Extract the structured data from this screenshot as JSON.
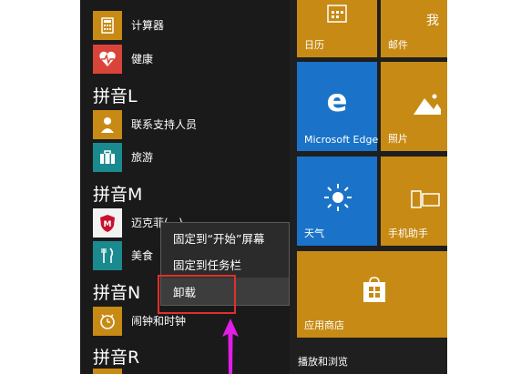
{
  "app_list": {
    "items": [
      {
        "label": "计算器",
        "name": "calculator"
      },
      {
        "label": "健康",
        "name": "health"
      },
      {
        "label": "联系支持人员",
        "name": "contact-support"
      },
      {
        "label": "旅游",
        "name": "travel"
      },
      {
        "label": "迈克菲(...)",
        "name": "mcafee"
      },
      {
        "label": "美食",
        "name": "food"
      },
      {
        "label": "闹钟和时钟",
        "name": "alarms-clock"
      }
    ],
    "headers": [
      "拼音L",
      "拼音M",
      "拼音N",
      "拼音R"
    ]
  },
  "tiles": {
    "calendar": "日历",
    "mail": "邮件",
    "edge": "Microsoft Edge",
    "photos": "照片",
    "weather": "天气",
    "phone_companion": "手机助手",
    "store": "应用商店",
    "group_label": "播放和浏览",
    "top_right_char": "我"
  },
  "context_menu": {
    "items": [
      "固定到“开始”屏幕",
      "固定到任务栏",
      "卸载"
    ]
  },
  "colors": {
    "tile_orange": "#c78a14",
    "tile_blue": "#1a73c8",
    "highlight_red": "#e0302c",
    "arrow_magenta": "#e01ee8"
  }
}
